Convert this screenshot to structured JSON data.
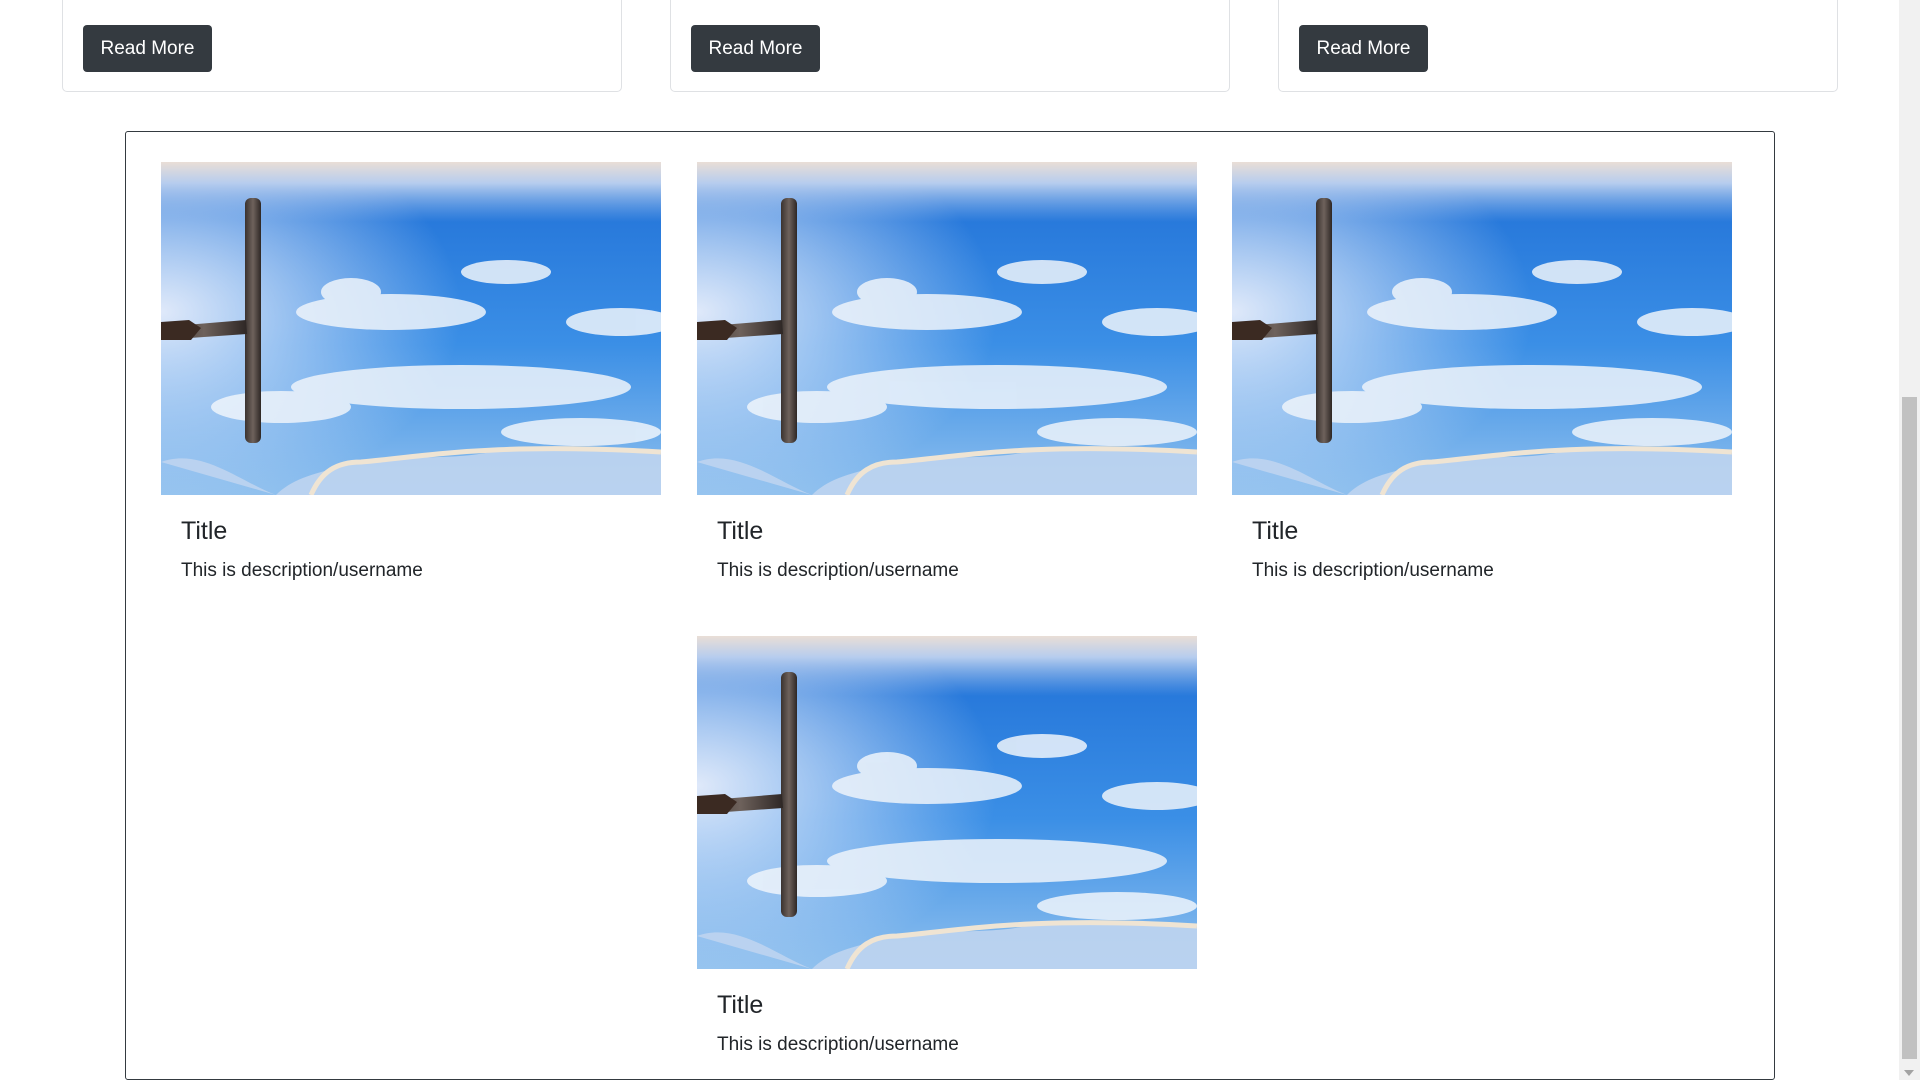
{
  "top_cards": [
    {
      "button_label": "Read More"
    },
    {
      "button_label": "Read More"
    },
    {
      "button_label": "Read More"
    }
  ],
  "gallery": {
    "items": [
      {
        "title": "Title",
        "description": "This is description/username"
      },
      {
        "title": "Title",
        "description": "This is description/username"
      },
      {
        "title": "Title",
        "description": "This is description/username"
      },
      {
        "title": "Title",
        "description": "This is description/username"
      }
    ]
  },
  "icons": {
    "scroll_down": "chevron-down-icon",
    "image": "window-squeegee-sky-image"
  },
  "colors": {
    "button_bg": "#343a40",
    "button_text": "#ffffff",
    "card_border": "#dfe1e4",
    "gallery_border": "#343a40",
    "sky_blue": "#2f86e0"
  }
}
